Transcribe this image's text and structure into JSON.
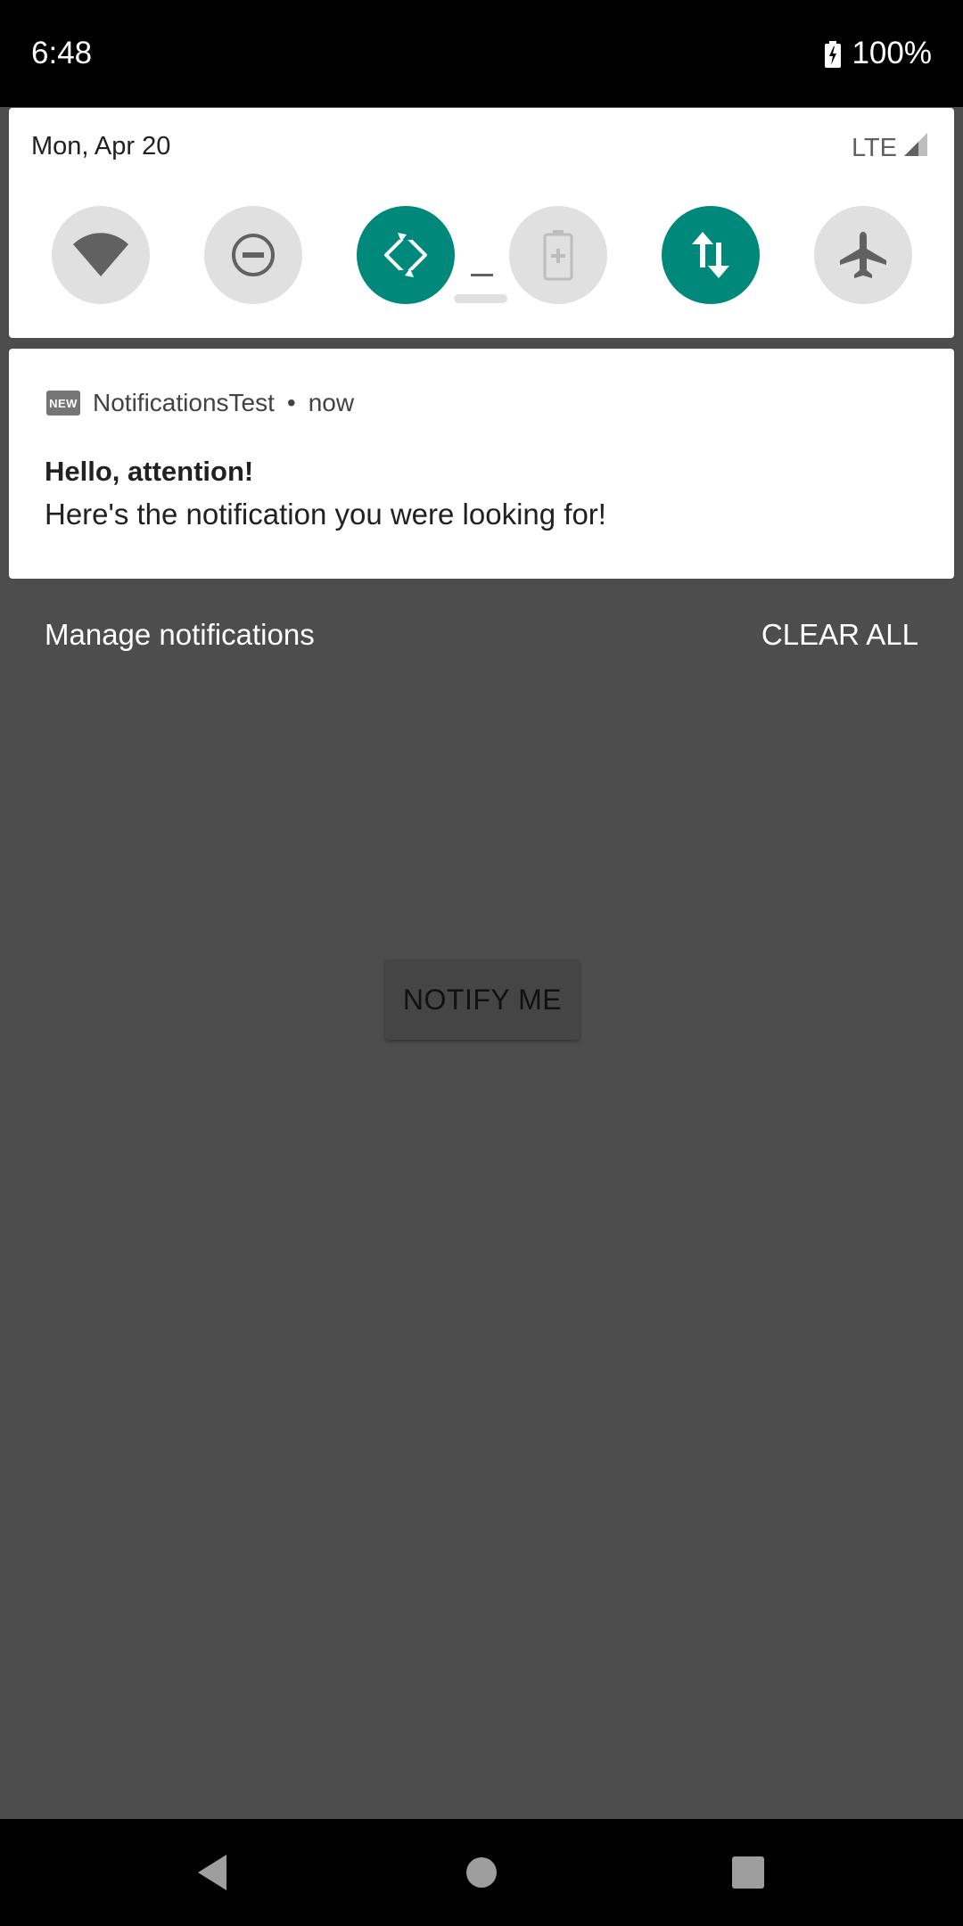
{
  "status_bar": {
    "time": "6:48",
    "battery": "100%"
  },
  "quick_settings": {
    "date": "Mon, Apr 20",
    "network": "LTE",
    "tiles": [
      {
        "icon": "wifi-icon",
        "state": "off"
      },
      {
        "icon": "do-not-disturb-icon",
        "state": "off"
      },
      {
        "icon": "auto-rotate-icon",
        "state": "on"
      },
      {
        "icon": "battery-saver-icon",
        "state": "disabled"
      },
      {
        "icon": "mobile-data-icon",
        "state": "on"
      },
      {
        "icon": "airplane-mode-icon",
        "state": "off"
      }
    ]
  },
  "notification": {
    "app_name": "NotificationsTest",
    "badge": "NEW",
    "separator": "•",
    "time": "now",
    "title": "Hello, attention!",
    "text": "Here's the notification you were looking for!"
  },
  "shade_actions": {
    "manage": "Manage notifications",
    "clear_all": "CLEAR ALL"
  },
  "app": {
    "button_label": "NOTIFY ME"
  },
  "colors": {
    "accent": "#00897b",
    "scrim": "#4d4d4d"
  }
}
